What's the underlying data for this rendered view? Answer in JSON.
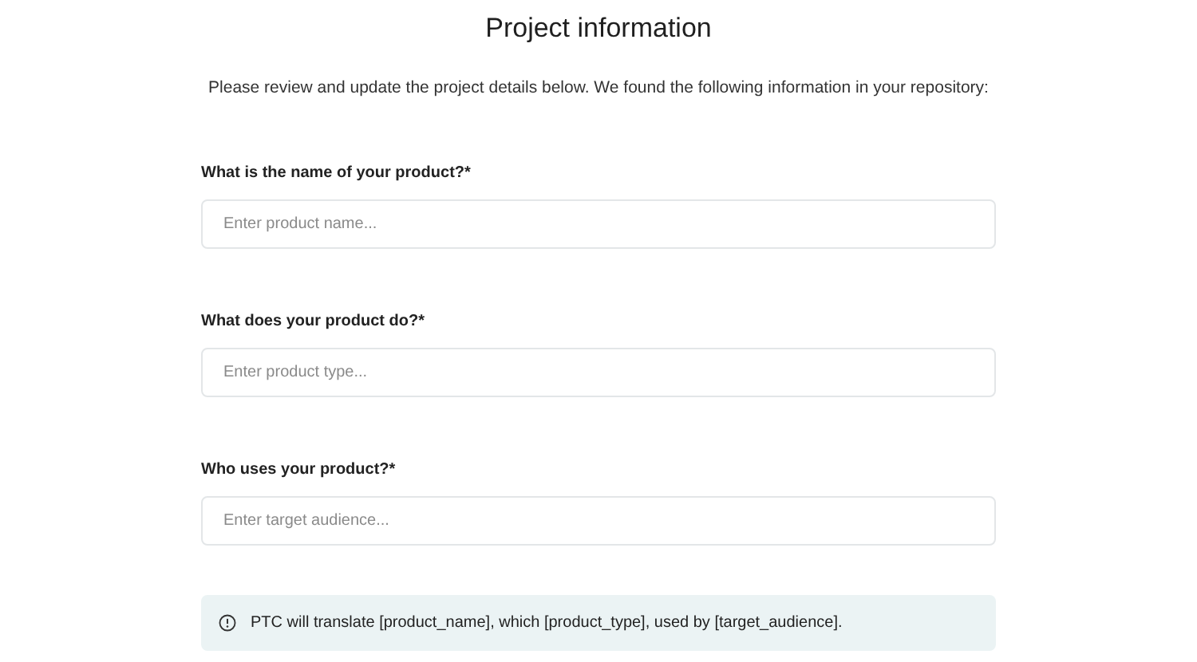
{
  "title": "Project information",
  "subtitle": "Please review and update the project details below. We found the following information in your repository:",
  "fields": [
    {
      "label": "What is the name of your product?*",
      "placeholder": "Enter product name..."
    },
    {
      "label": "What does your product do?*",
      "placeholder": "Enter product type..."
    },
    {
      "label": "Who uses your product?*",
      "placeholder": "Enter target audience..."
    }
  ],
  "info": "PTC will translate [product_name], which [product_type], used by [target_audience]."
}
